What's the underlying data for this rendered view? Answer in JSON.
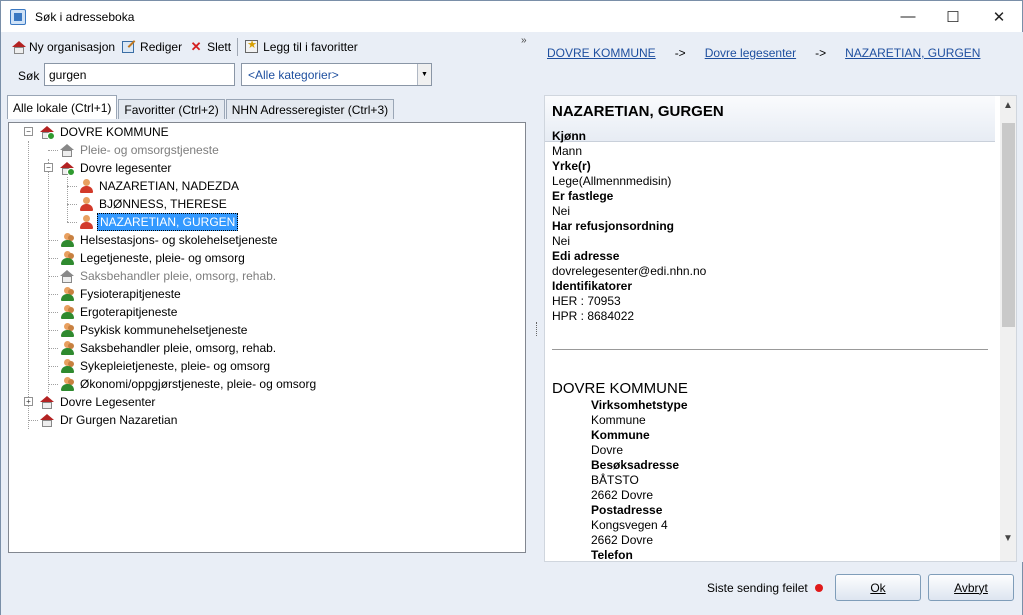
{
  "window": {
    "title": "Søk i adresseboka"
  },
  "toolbar": {
    "new_org": "Ny organisasjon",
    "edit": "Rediger",
    "delete": "Slett",
    "favorite": "Legg til i favoritter",
    "overflow": "»"
  },
  "search": {
    "label": "Søk",
    "value": "gurgen",
    "category": "<Alle kategorier>"
  },
  "tabs": [
    "Alle lokale (Ctrl+1)",
    "Favoritter (Ctrl+2)",
    "NHN Adresseregister (Ctrl+3)"
  ],
  "tree": {
    "root": "DOVRE KOMMUNE",
    "pleie": "Pleie- og omsorgstjeneste",
    "legesenter": "Dovre legesenter",
    "p1": "NAZARETIAN, NADEZDA",
    "p2": "BJØNNESS, THERESE",
    "p3": "NAZARETIAN, GURGEN",
    "s1": "Helsestasjons- og skolehelsetjeneste",
    "s2": "Legetjeneste, pleie- og omsorg",
    "s3": "Saksbehandler pleie, omsorg, rehab.",
    "s4": "Fysioterapitjeneste",
    "s5": "Ergoterapitjeneste",
    "s6": "Psykisk kommunehelsetjeneste",
    "s7": "Saksbehandler pleie, omsorg, rehab.",
    "s8": "Sykepleietjeneste, pleie- og omsorg",
    "s9": "Økonomi/oppgjørstjeneste, pleie- og omsorg",
    "r2": "Dovre Legesenter",
    "r3": "Dr Gurgen Nazaretian"
  },
  "breadcrumb": {
    "c1": "DOVRE KOMMUNE",
    "c2": "Dovre legesenter",
    "c3": "NAZARETIAN, GURGEN",
    "sep": "->"
  },
  "detail": {
    "name": "NAZARETIAN, GURGEN",
    "kjonn_label": "Kjønn",
    "kjonn": "Mann",
    "yrke_label": "Yrke(r)",
    "yrke": "Lege(Allmennmedisin)",
    "fastlege_label": "Er fastlege",
    "fastlege": "Nei",
    "refusjon_label": "Har refusjonsordning",
    "refusjon": "Nei",
    "edi_label": "Edi adresse",
    "edi": "dovrelegesenter@edi.nhn.no",
    "id_label": "Identifikatorer",
    "her": "HER : 70953",
    "hpr": "HPR : 8684022"
  },
  "org": {
    "name": "DOVRE KOMMUNE",
    "type_label": "Virksomhetstype",
    "type": "Kommune",
    "kommune_label": "Kommune",
    "kommune": "Dovre",
    "besok_label": "Besøksadresse",
    "besok1": "BÅTSTO",
    "besok2": "2662 Dovre",
    "post_label": "Postadresse",
    "post1": "Kongsvegen 4",
    "post2": "2662 Dovre",
    "tlf_label": "Telefon"
  },
  "footer": {
    "status": "Siste sending feilet",
    "ok": "Ok",
    "cancel": "Avbryt"
  },
  "colors": {
    "link": "#1e4f9f",
    "selection": "#3399ff",
    "error_dot": "#e01a1a"
  }
}
